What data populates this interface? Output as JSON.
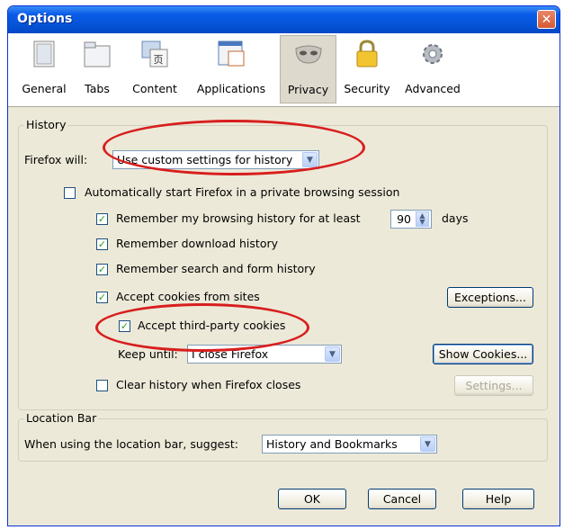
{
  "window": {
    "title": "Options",
    "close_glyph": "✕"
  },
  "toolbar": {
    "items": [
      {
        "label": "General",
        "icon": "general-icon"
      },
      {
        "label": "Tabs",
        "icon": "tabs-icon"
      },
      {
        "label": "Content",
        "icon": "content-icon"
      },
      {
        "label": "Applications",
        "icon": "applications-icon"
      },
      {
        "label": "Privacy",
        "icon": "privacy-mask-icon",
        "selected": true
      },
      {
        "label": "Security",
        "icon": "lock-icon"
      },
      {
        "label": "Advanced",
        "icon": "gear-icon"
      }
    ]
  },
  "history": {
    "legend": "History",
    "firefox_will_label": "Firefox will:",
    "firefox_will_value": "Use custom settings for history",
    "private_browsing": {
      "label": "Automatically start Firefox in a private browsing session",
      "checked": false
    },
    "remember_history": {
      "label": "Remember my browsing history for at least",
      "checked": true,
      "days_value": "90",
      "days_unit": "days"
    },
    "remember_downloads": {
      "label": "Remember download history",
      "checked": true
    },
    "remember_search": {
      "label": "Remember search and form history",
      "checked": true
    },
    "accept_cookies": {
      "label": "Accept cookies from sites",
      "checked": true
    },
    "exceptions_button": "Exceptions...",
    "third_party": {
      "label": "Accept third-party cookies",
      "checked": true
    },
    "keep_until_label": "Keep until:",
    "keep_until_value": "I close Firefox",
    "show_cookies_button": "Show Cookies...",
    "clear_history": {
      "label": "Clear history when Firefox closes",
      "checked": false
    },
    "settings_button": "Settings..."
  },
  "location_bar": {
    "legend": "Location Bar",
    "suggest_label": "When using the location bar, suggest:",
    "suggest_value": "History and Bookmarks"
  },
  "buttons": {
    "ok": "OK",
    "cancel": "Cancel",
    "help": "Help"
  },
  "colors": {
    "annotation_red": "#d81e1e",
    "titlebar_blue": "#0553d6",
    "dialog_bg": "#ece9d8"
  }
}
